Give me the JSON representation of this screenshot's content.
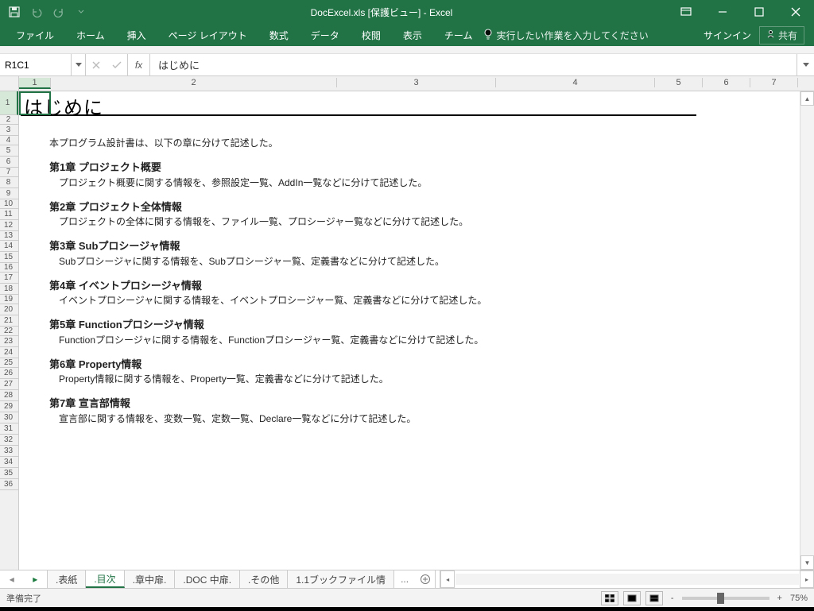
{
  "title_bar": {
    "doc_title": "DocExcel.xls [保護ビュー] - Excel"
  },
  "ribbon": {
    "tabs": [
      "ファイル",
      "ホーム",
      "挿入",
      "ページ レイアウト",
      "数式",
      "データ",
      "校閲",
      "表示",
      "チーム"
    ],
    "tell_me": "実行したい作業を入力してください",
    "sign_in": "サインイン",
    "share": "共有"
  },
  "fx": {
    "name_box": "R1C1",
    "fx_label": "fx",
    "formula": "はじめに"
  },
  "columns": {
    "labels": [
      "1",
      "2",
      "3",
      "4",
      "5",
      "6",
      "7"
    ],
    "widths": [
      40,
      360,
      200,
      200,
      60,
      60,
      60
    ]
  },
  "rows": {
    "heights": [
      30,
      12,
      14,
      12,
      14,
      14,
      12,
      14,
      14,
      12,
      14,
      14,
      12,
      14,
      14,
      12,
      14,
      14,
      12,
      14,
      14,
      12,
      14,
      14,
      12,
      14,
      14,
      14,
      14,
      14,
      14,
      14,
      14,
      14,
      14,
      14
    ],
    "count": 36
  },
  "content": {
    "title": "はじめに",
    "intro": "本プログラム設計書は、以下の章に分けて記述した。",
    "chapters": [
      {
        "title": "第1章 プロジェクト概要",
        "desc": "プロジェクト概要に関する情報を、参照設定一覧、AddIn一覧などに分けて記述した。"
      },
      {
        "title": "第2章 プロジェクト全体情報",
        "desc": "プロジェクトの全体に関する情報を、ファイル一覧、プロシージャー覧などに分けて記述した。"
      },
      {
        "title": "第3章 Subプロシージャ情報",
        "desc": "Subプロシージャに関する情報を、Subプロシージャー覧、定義書などに分けて記述した。"
      },
      {
        "title": "第4章 イベントプロシージャ情報",
        "desc": "イベントプロシージャに関する情報を、イベントプロシージャー覧、定義書などに分けて記述した。"
      },
      {
        "title": "第5章 Functionプロシージャ情報",
        "desc": "Functionプロシージャに関する情報を、Functionプロシージャー覧、定義書などに分けて記述した。"
      },
      {
        "title": "第6章 Property情報",
        "desc": "Property情報に関する情報を、Property一覧、定義書などに分けて記述した。"
      },
      {
        "title": "第7章 宣言部情報",
        "desc": "宣言部に関する情報を、変数一覧、定数一覧、Declare一覧などに分けて記述した。"
      }
    ]
  },
  "sheets": {
    "tabs": [
      ".表紙",
      ".目次",
      ".章中扉.",
      ".DOC 中扉.",
      ".その他",
      "1.1ブックファイル情"
    ],
    "active_index": 1,
    "more": "..."
  },
  "status": {
    "ready": "準備完了",
    "zoom": "75%",
    "minus": "-",
    "plus": "+"
  }
}
